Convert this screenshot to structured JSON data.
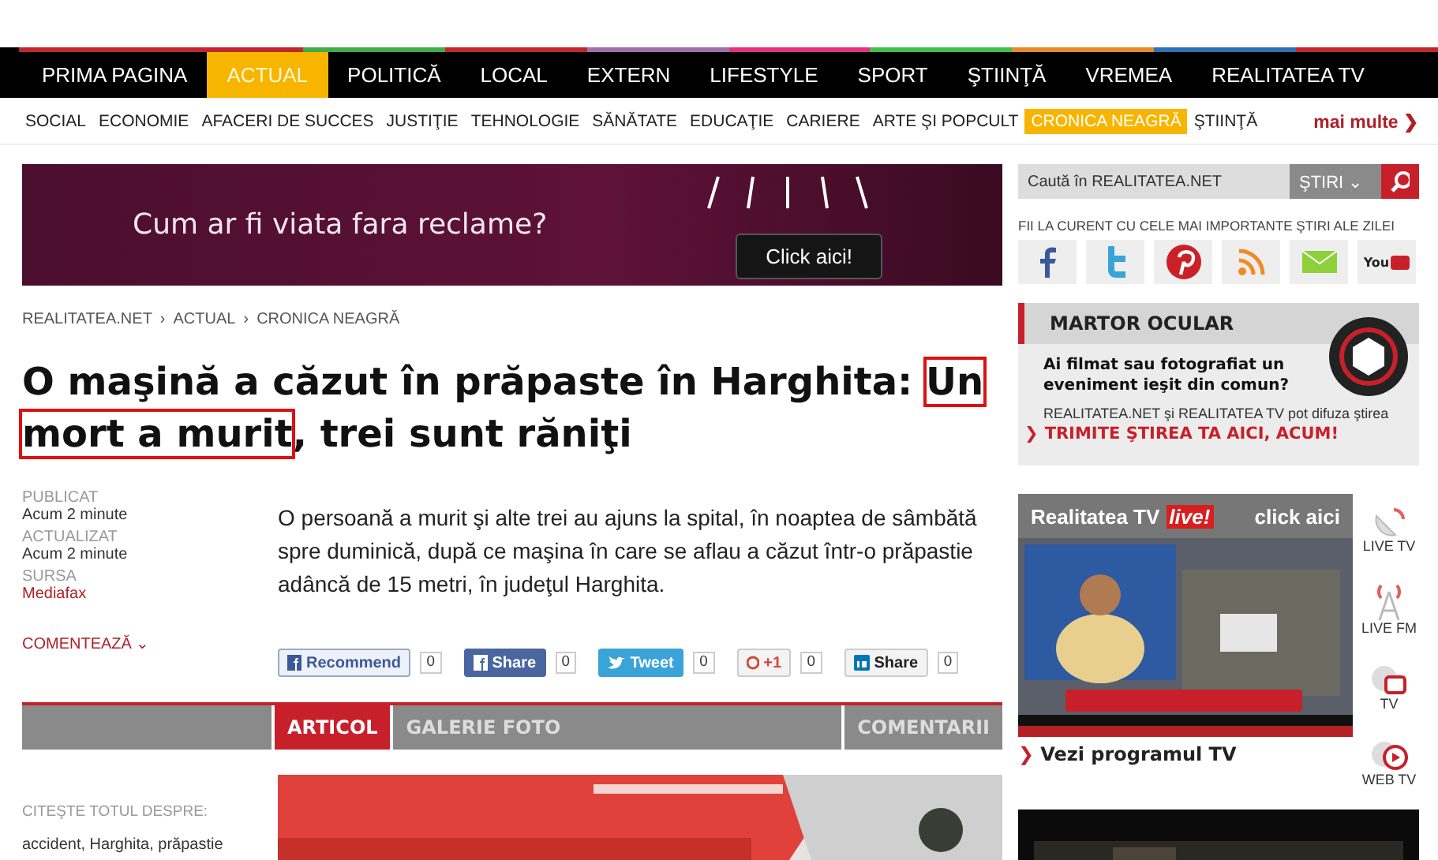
{
  "nav": {
    "items": [
      {
        "label": "PRIMA PAGINA",
        "selected": false,
        "color": "#c0262d"
      },
      {
        "label": "ACTUAL",
        "selected": true,
        "color": "#c0262d"
      },
      {
        "label": "POLITICĂ",
        "selected": false,
        "color": "#3fae49"
      },
      {
        "label": "LOCAL",
        "selected": false,
        "color": "#c0262d"
      },
      {
        "label": "EXTERN",
        "selected": false,
        "color": "#a071a8"
      },
      {
        "label": "LIFESTYLE",
        "selected": false,
        "color": "#e2337a"
      },
      {
        "label": "SPORT",
        "selected": false,
        "color": "#3fc04a"
      },
      {
        "label": "ŞTIINŢĂ",
        "selected": false,
        "color": "#e58a2b"
      },
      {
        "label": "VREMEA",
        "selected": false,
        "color": "#2e6fb7"
      },
      {
        "label": "REALITATEA TV",
        "selected": false,
        "color": "#c0262d"
      }
    ]
  },
  "subnav": {
    "items": [
      {
        "label": "SOCIAL",
        "selected": false
      },
      {
        "label": "ECONOMIE",
        "selected": false
      },
      {
        "label": "AFACERI DE SUCCES",
        "selected": false
      },
      {
        "label": "JUSTIŢIE",
        "selected": false
      },
      {
        "label": "TEHNOLOGIE",
        "selected": false
      },
      {
        "label": "SĂNĂTATE",
        "selected": false
      },
      {
        "label": "EDUCAŢIE",
        "selected": false
      },
      {
        "label": "CARIERE",
        "selected": false
      },
      {
        "label": "ARTE ŞI POPCULT",
        "selected": false
      },
      {
        "label": "CRONICA NEAGRĂ",
        "selected": true
      },
      {
        "label": "ŞTIINŢĂ",
        "selected": false
      }
    ],
    "more": "mai multe",
    "more_arrow": "❯"
  },
  "ad": {
    "text": "Cum ar fi viata fara reclame?",
    "button": "Click aici!"
  },
  "breadcrumb": [
    "REALITATEA.NET",
    "ACTUAL",
    "CRONICA NEAGRĂ"
  ],
  "breadcrumb_separator": "›",
  "headline": [
    {
      "text": "O maşină a căzut în prăpaste în Harghita: ",
      "highlighted": false
    },
    {
      "text": "Un ",
      "highlighted": true
    },
    {
      "text": "mort a murit",
      "highlighted": true
    },
    {
      "text": ", trei sunt răniţi",
      "highlighted": false
    }
  ],
  "meta": [
    {
      "label": "PUBLICAT",
      "value": "Acum 2 minute",
      "kind": "plain"
    },
    {
      "label": "ACTUALIZAT",
      "value": "Acum 2 minute",
      "kind": "plain"
    },
    {
      "label": "SURSA",
      "value": "Mediafax",
      "kind": "link"
    }
  ],
  "comment_link": "COMENTEAZĂ",
  "comment_arrow": "⌄",
  "lead": "O persoană a murit şi alte trei au ajuns la spital, în noaptea de sâmbătă spre duminică, după ce maşina în care se aflau a căzut într-o prăpastie adâncă de 15 metri, în judeţul Harghita.",
  "share": [
    {
      "kind": "recommend",
      "label": "Recommend",
      "count": "0"
    },
    {
      "kind": "facebook",
      "label": "Share",
      "count": "0"
    },
    {
      "kind": "tweet",
      "label": "Tweet",
      "count": "0"
    },
    {
      "kind": "plus",
      "label": "+1",
      "count": "0"
    },
    {
      "kind": "linkedin",
      "label": "Share",
      "count": "0"
    }
  ],
  "article_tabs": [
    {
      "label": "ARTICOL",
      "selected": true
    },
    {
      "label": "GALERIE FOTO",
      "selected": false
    },
    {
      "label": "COMENTARII",
      "selected": false
    }
  ],
  "tags_title": "CITEŞTE TOTUL DESPRE:",
  "tags": "accident, Harghita, prăpastie",
  "search": {
    "placeholder": "Caută în REALITATEA.NET",
    "scope": "ŞTIRI",
    "scope_arrow": "⌄"
  },
  "follow": {
    "title": "FII LA CURENT CU CELE MAI IMPORTANTE ŞTIRI ALE ZILEI",
    "icons": [
      {
        "kind": "facebook"
      },
      {
        "kind": "twitter"
      },
      {
        "kind": "pinterest"
      },
      {
        "kind": "rss"
      },
      {
        "kind": "email"
      },
      {
        "kind": "youtube",
        "label": "You"
      }
    ]
  },
  "witness": {
    "title": "MARTOR OCULAR",
    "question": "Ai filmat sau fotografiat un eveniment ieşit din comun?",
    "text": "REALITATEA.NET şi REALITATEA TV pot difuza ştirea",
    "link": "TRIMITE ŞTIREA TA AICI, ACUM!",
    "arrow": "❯"
  },
  "tv": {
    "title": "Realitatea TV",
    "live": "live!",
    "cta": "click aici",
    "program": "Vezi programul TV",
    "arrow": "❯"
  },
  "channels": [
    {
      "kind": "tv",
      "label": "LIVE TV"
    },
    {
      "kind": "fm",
      "label": "LIVE FM"
    },
    {
      "kind": "screen",
      "label": "TV"
    },
    {
      "kind": "play",
      "label": "WEB TV"
    }
  ]
}
